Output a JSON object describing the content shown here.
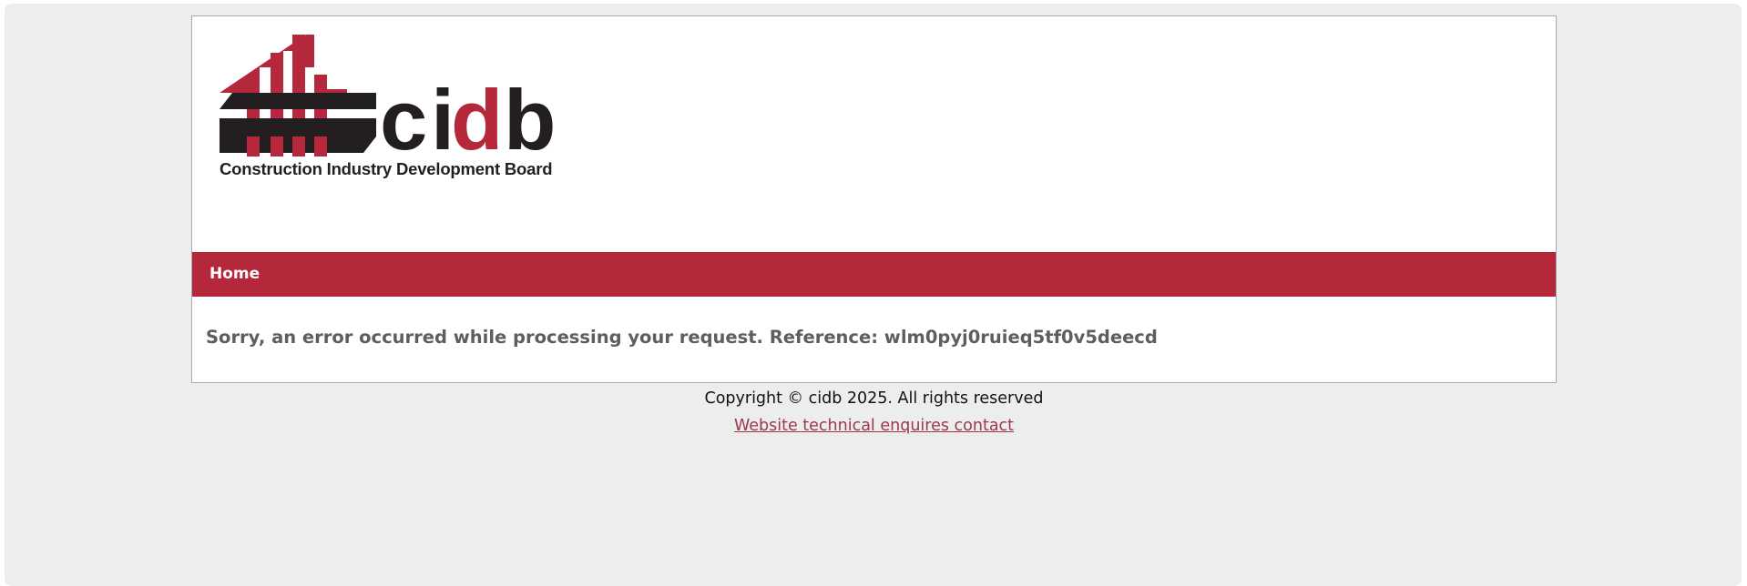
{
  "logo": {
    "wordmark": "cidb",
    "subtitle": "Construction Industry Development Board"
  },
  "nav": {
    "items": [
      {
        "label": "Home"
      }
    ]
  },
  "main": {
    "error_message": "Sorry, an error occurred while processing your request. Reference: wlm0pyj0ruieq5tf0v5deecd"
  },
  "footer": {
    "copyright": "Copyright © cidb 2025. All rights reserved",
    "contact_link": "Website technical enquires contact"
  },
  "colors": {
    "brand_red": "#b5273a",
    "logo_dark": "#231f20",
    "page_background": "#eceeee",
    "link": "#a1354a"
  }
}
